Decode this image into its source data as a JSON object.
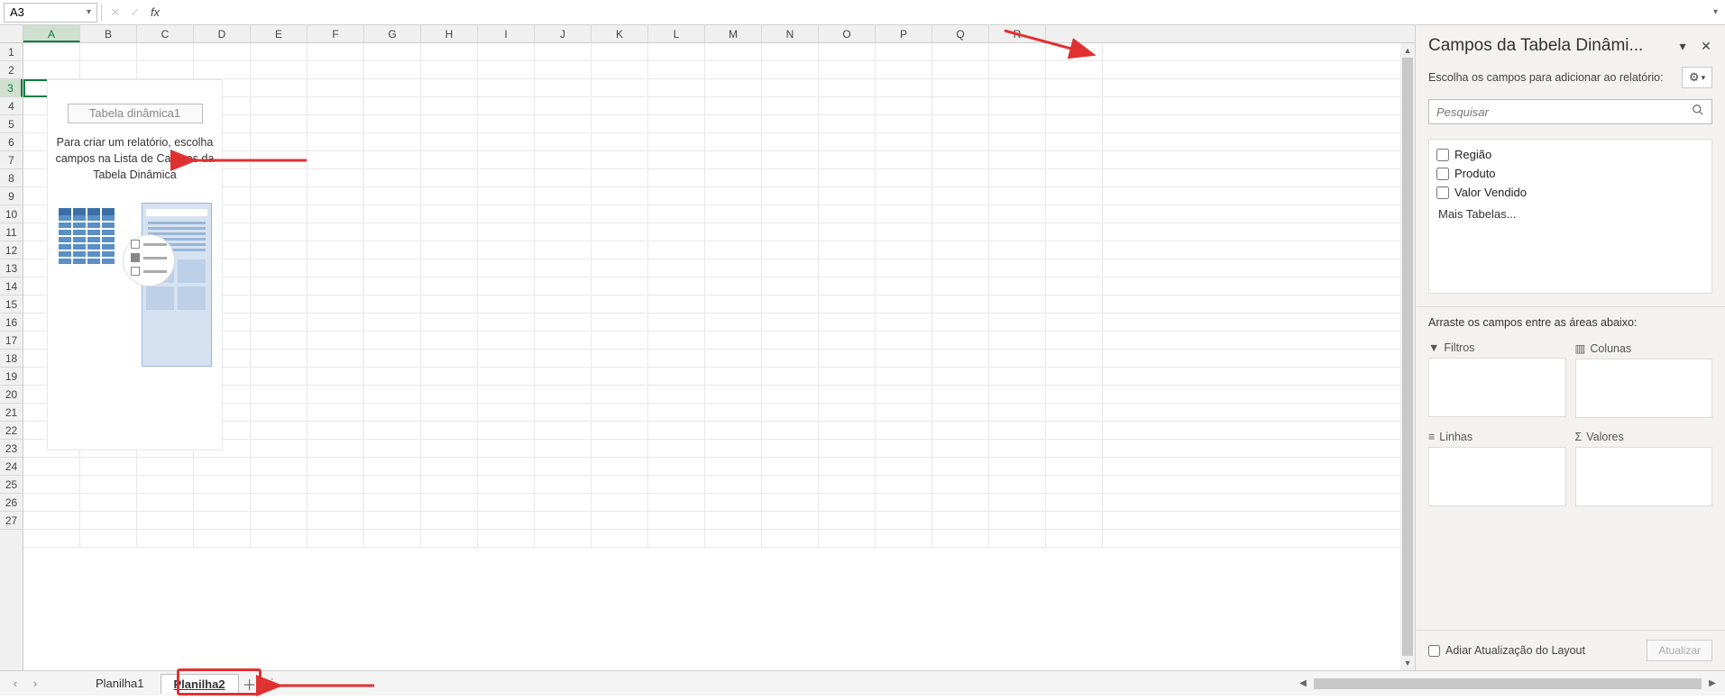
{
  "formula_bar": {
    "namebox": "A3",
    "fx_label": "fx"
  },
  "columns": [
    "A",
    "B",
    "C",
    "D",
    "E",
    "F",
    "G",
    "H",
    "I",
    "J",
    "K",
    "L",
    "M",
    "N",
    "O",
    "P",
    "Q",
    "R"
  ],
  "rows": [
    "1",
    "2",
    "3",
    "4",
    "5",
    "6",
    "7",
    "8",
    "9",
    "10",
    "11",
    "12",
    "13",
    "14",
    "15",
    "16",
    "17",
    "18",
    "19",
    "20",
    "21",
    "22",
    "23",
    "24",
    "25",
    "26",
    "27"
  ],
  "selected_col": "A",
  "selected_row": "3",
  "pivot": {
    "name": "Tabela dinâmica1",
    "msg": "Para criar um relatório, escolha campos na Lista de Campos da Tabela Dinâmica"
  },
  "panel": {
    "title": "Campos da Tabela Dinâmi...",
    "subtitle": "Escolha os campos para adicionar ao relatório:",
    "search_placeholder": "Pesquisar",
    "fields": [
      "Região",
      "Produto",
      "Valor Vendido"
    ],
    "more_tables": "Mais Tabelas...",
    "drag_label": "Arraste os campos entre as áreas abaixo:",
    "areas": {
      "filters": "Filtros",
      "columns": "Colunas",
      "rows": "Linhas",
      "values": "Valores"
    },
    "defer_label": "Adiar Atualização do Layout",
    "update_btn": "Atualizar"
  },
  "tabs": {
    "sheet1": "Planilha1",
    "sheet2": "Planilha2"
  }
}
